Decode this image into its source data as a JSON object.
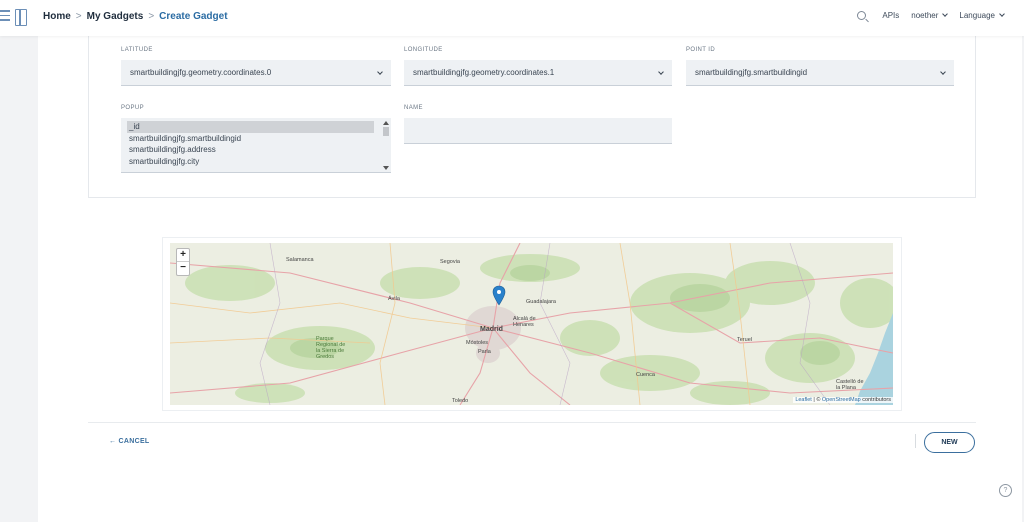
{
  "breadcrumb": {
    "home": "Home",
    "my_gadgets": "My Gadgets",
    "current": "Create Gadget",
    "sep": ">"
  },
  "topbar": {
    "apis": "APIs",
    "user": "noether",
    "language": "Language"
  },
  "form": {
    "latitude": {
      "label": "LATITUDE",
      "value": "smartbuildingjfg.geometry.coordinates.0"
    },
    "longitude": {
      "label": "LONGITUDE",
      "value": "smartbuildingjfg.geometry.coordinates.1"
    },
    "point_id": {
      "label": "POINT ID",
      "value": "smartbuildingjfg.smartbuildingid"
    },
    "popup": {
      "label": "POPUP",
      "options": [
        "_id",
        "smartbuildingjfg.smartbuildingid",
        "smartbuildingjfg.address",
        "smartbuildingjfg.city"
      ],
      "selected": "_id"
    },
    "name": {
      "label": "NAME",
      "value": ""
    }
  },
  "map": {
    "zoom_in": "+",
    "zoom_out": "−",
    "attribution_leaflet": "Leaflet",
    "attribution_sep": " | © ",
    "attribution_osm": "OpenStreetMap",
    "attribution_suffix": " contributors",
    "labels": {
      "madrid": "Madrid",
      "salamanca": "Salamanca",
      "segovia": "Segovia",
      "avila": "Ávila",
      "guadalajara": "Guadalajara",
      "alcala": "Alcalá de Henares",
      "mostoles": "Móstoles",
      "parla": "Parla",
      "cuenca": "Cuenca",
      "teruel": "Teruel",
      "toledo": "Toledo",
      "castellon": "Castelló de la Plana",
      "gredos": "Parque Regional de la Sierra de Gredos"
    }
  },
  "actions": {
    "cancel": "← CANCEL",
    "new": "NEW"
  },
  "help": "?"
}
